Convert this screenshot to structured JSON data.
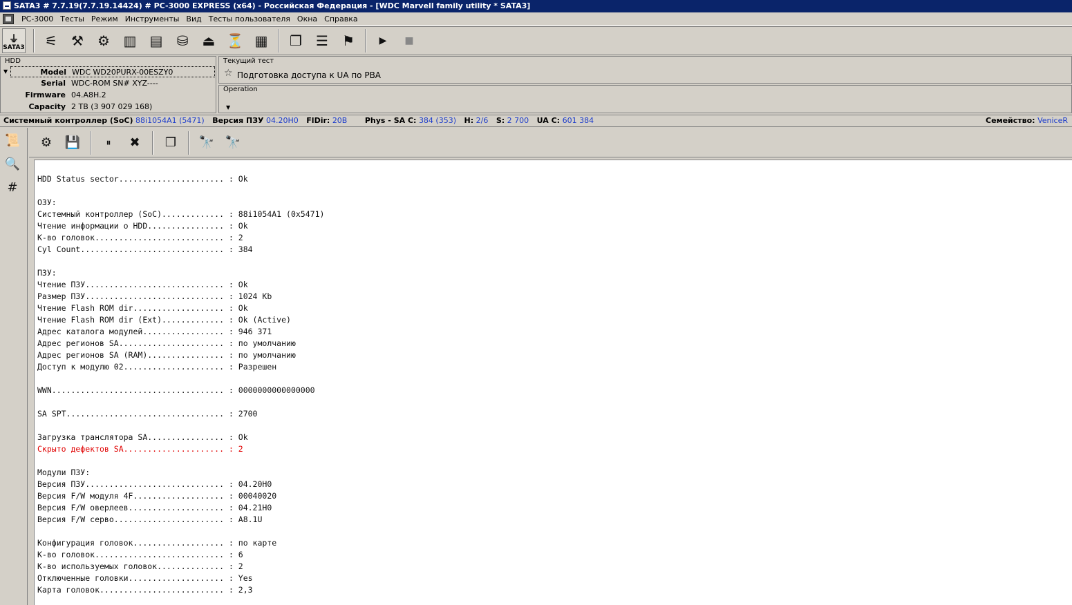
{
  "window": {
    "title": "SATA3 # 7.7.19(7.7.19.14424) # PC-3000 EXPRESS (x64) - Российская Федерация - [WDC Marvell family utility * SATA3]"
  },
  "menu": {
    "items": [
      "PC-3000",
      "Тесты",
      "Режим",
      "Инструменты",
      "Вид",
      "Тесты пользователя",
      "Окна",
      "Справка"
    ]
  },
  "toolbar": {
    "sata_label": "SATA3"
  },
  "hdd": {
    "title": "HDD",
    "fields": [
      {
        "label": "Model",
        "value": "WDC WD20PURX-00ESZY0"
      },
      {
        "label": "Serial",
        "value": "WDC-ROM SN# XYZ----"
      },
      {
        "label": "Firmware",
        "value": "04.A8H.2"
      },
      {
        "label": "Capacity",
        "value": "2 TB (3 907 029 168)"
      }
    ]
  },
  "current_test": {
    "title": "Текущий тест",
    "name": "Подготовка доступа к UA по PBA"
  },
  "operation": {
    "title": "Operation"
  },
  "status": {
    "soc_label": "Системный контроллер (SoC)",
    "soc_value": "88i1054A1 (5471)",
    "rom_label": "Версия ПЗУ",
    "rom_value": "04.20H0",
    "fldir_label": "FlDir:",
    "fldir_value": "20B",
    "phys_label": "Phys - SA C:",
    "phys_value": "384 (353)",
    "h_label": "H:",
    "h_value": "2/6",
    "s_label": "S:",
    "s_value": "2 700",
    "uac_label": "UA C:",
    "uac_value": "601 384",
    "family_label": "Семейство:",
    "family_value": "VeniceR"
  },
  "log": {
    "lines": [
      {
        "text": "HDD Status sector...................... : Ok"
      },
      {
        "text": ""
      },
      {
        "text": "ОЗУ:"
      },
      {
        "text": "Системный контроллер (SoC)............. : 88i1054A1 (0x5471)"
      },
      {
        "text": "Чтение информации о HDD................ : Ok"
      },
      {
        "text": "К-во головок........................... : 2"
      },
      {
        "text": "Cyl Count.............................. : 384"
      },
      {
        "text": ""
      },
      {
        "text": "ПЗУ:"
      },
      {
        "text": "Чтение ПЗУ............................. : Ok"
      },
      {
        "text": "Размер ПЗУ............................. : 1024 Kb"
      },
      {
        "text": "Чтение Flash ROM dir................... : Ok"
      },
      {
        "text": "Чтение Flash ROM dir (Ext)............. : Ok (Active)"
      },
      {
        "text": "Адрес каталога модулей................. : 946 371"
      },
      {
        "text": "Адрес регионов SA...................... : по умолчанию"
      },
      {
        "text": "Адрес регионов SA (RAM)................ : по умолчанию"
      },
      {
        "text": "Доступ к модулю 02..................... : Разрешен"
      },
      {
        "text": ""
      },
      {
        "text": "WWN.................................... : 0000000000000000"
      },
      {
        "text": ""
      },
      {
        "text": "SA SPT................................. : 2700"
      },
      {
        "text": ""
      },
      {
        "text": "Загрузка транслятора SA................ : Ok"
      },
      {
        "text": "Скрыто дефектов SA..................... : 2",
        "highlight": true
      },
      {
        "text": ""
      },
      {
        "text": "Модули ПЗУ:"
      },
      {
        "text": "Версия ПЗУ............................. : 04.20H0"
      },
      {
        "text": "Версия F/W модуля 4F................... : 00040020"
      },
      {
        "text": "Версия F/W оверлеев.................... : 04.21H0"
      },
      {
        "text": "Версия F/W серво....................... : A8.1U"
      },
      {
        "text": ""
      },
      {
        "text": "Конфигурация головок................... : по карте"
      },
      {
        "text": "К-во головок........................... : 6"
      },
      {
        "text": "К-во используемых головок.............. : 2"
      },
      {
        "text": "Отключенные головки.................... : Yes"
      },
      {
        "text": "Карта головок.......................... : 2,3"
      }
    ]
  },
  "colors": {
    "status_value": "#1c3ccb",
    "error_text": "#e00000",
    "titlebar_bg": "#0a246a"
  }
}
